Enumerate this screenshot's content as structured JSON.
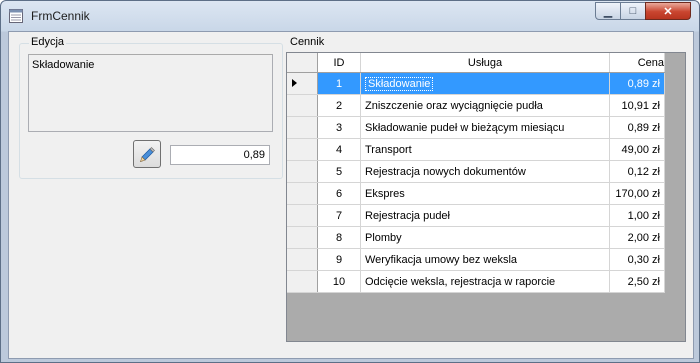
{
  "window": {
    "title": "FrmCennik",
    "minimize_glyph": "▁",
    "maximize_glyph": "□",
    "close_glyph": "✕"
  },
  "edycja": {
    "group_label": "Edycja",
    "description": "Składowanie",
    "edit_icon": "pencil-icon",
    "price_value": "0,89"
  },
  "cennik": {
    "group_label": "Cennik",
    "columns": [
      "ID",
      "Usługa",
      "Cena"
    ],
    "rows": [
      {
        "id": "1",
        "usluga": "Składowanie",
        "cena": "0,89 zł"
      },
      {
        "id": "2",
        "usluga": "Zniszczenie oraz wyciągnięcie pudła",
        "cena": "10,91 zł"
      },
      {
        "id": "3",
        "usluga": "Składowanie pudeł w bieżącym miesiącu",
        "cena": "0,89 zł"
      },
      {
        "id": "4",
        "usluga": "Transport",
        "cena": "49,00 zł"
      },
      {
        "id": "5",
        "usluga": "Rejestracja nowych dokumentów",
        "cena": "0,12 zł"
      },
      {
        "id": "6",
        "usluga": "Ekspres",
        "cena": "170,00 zł"
      },
      {
        "id": "7",
        "usluga": "Rejestracja pudeł",
        "cena": "1,00 zł"
      },
      {
        "id": "8",
        "usluga": "Plomby",
        "cena": "2,00 zł"
      },
      {
        "id": "9",
        "usluga": "Weryfikacja umowy bez weksla",
        "cena": "0,30 zł"
      },
      {
        "id": "10",
        "usluga": "Odcięcie weksla, rejestracja w raporcie",
        "cena": "2,50 zł"
      }
    ],
    "selected_index": 0,
    "selection_color": "#3399ff"
  }
}
